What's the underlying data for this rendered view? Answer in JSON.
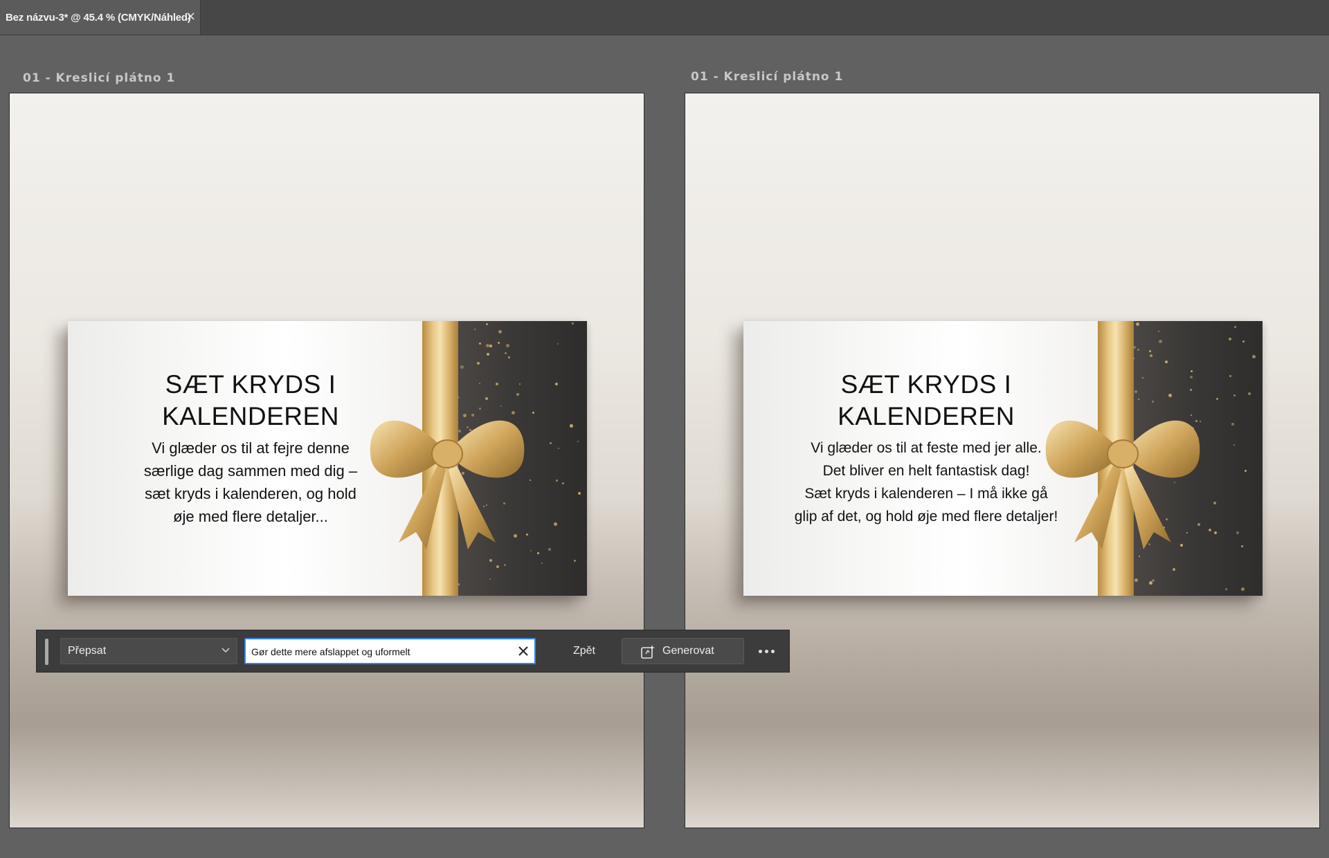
{
  "tab": {
    "title": "Bez názvu-3* @ 45.4 % (CMYK/Náhled)",
    "close": "×"
  },
  "artboards": [
    {
      "label": "01 - Kreslicí plátno 1",
      "card": {
        "heading": [
          "SÆT KRYDS I",
          "KALENDEREN"
        ],
        "body": "Vi glæder os til at fejre denne\nsærlige dag sammen med dig –\nsæt kryds i kalenderen, og hold\nøje med flere detaljer..."
      }
    },
    {
      "label": "01 - Kreslicí plátno 1",
      "card": {
        "heading": [
          "SÆT KRYDS I",
          "KALENDEREN"
        ],
        "body": "Vi glæder os til at feste med jer alle.\nDet bliver en helt fantastisk dag!\nSæt kryds i kalenderen – I må ikke gå\nglip af det, og hold øje med flere detaljer!"
      }
    }
  ],
  "toolbar": {
    "mode": "Přepsat",
    "prompt_value": "Gør dette mere afslappet og uformelt",
    "undo_label": "Zpět",
    "generate_label": "Generovat"
  },
  "colors": {
    "focus_border": "#2f86ff",
    "ribbon_gold": "#d9b26a",
    "card_dark": "#363432"
  }
}
